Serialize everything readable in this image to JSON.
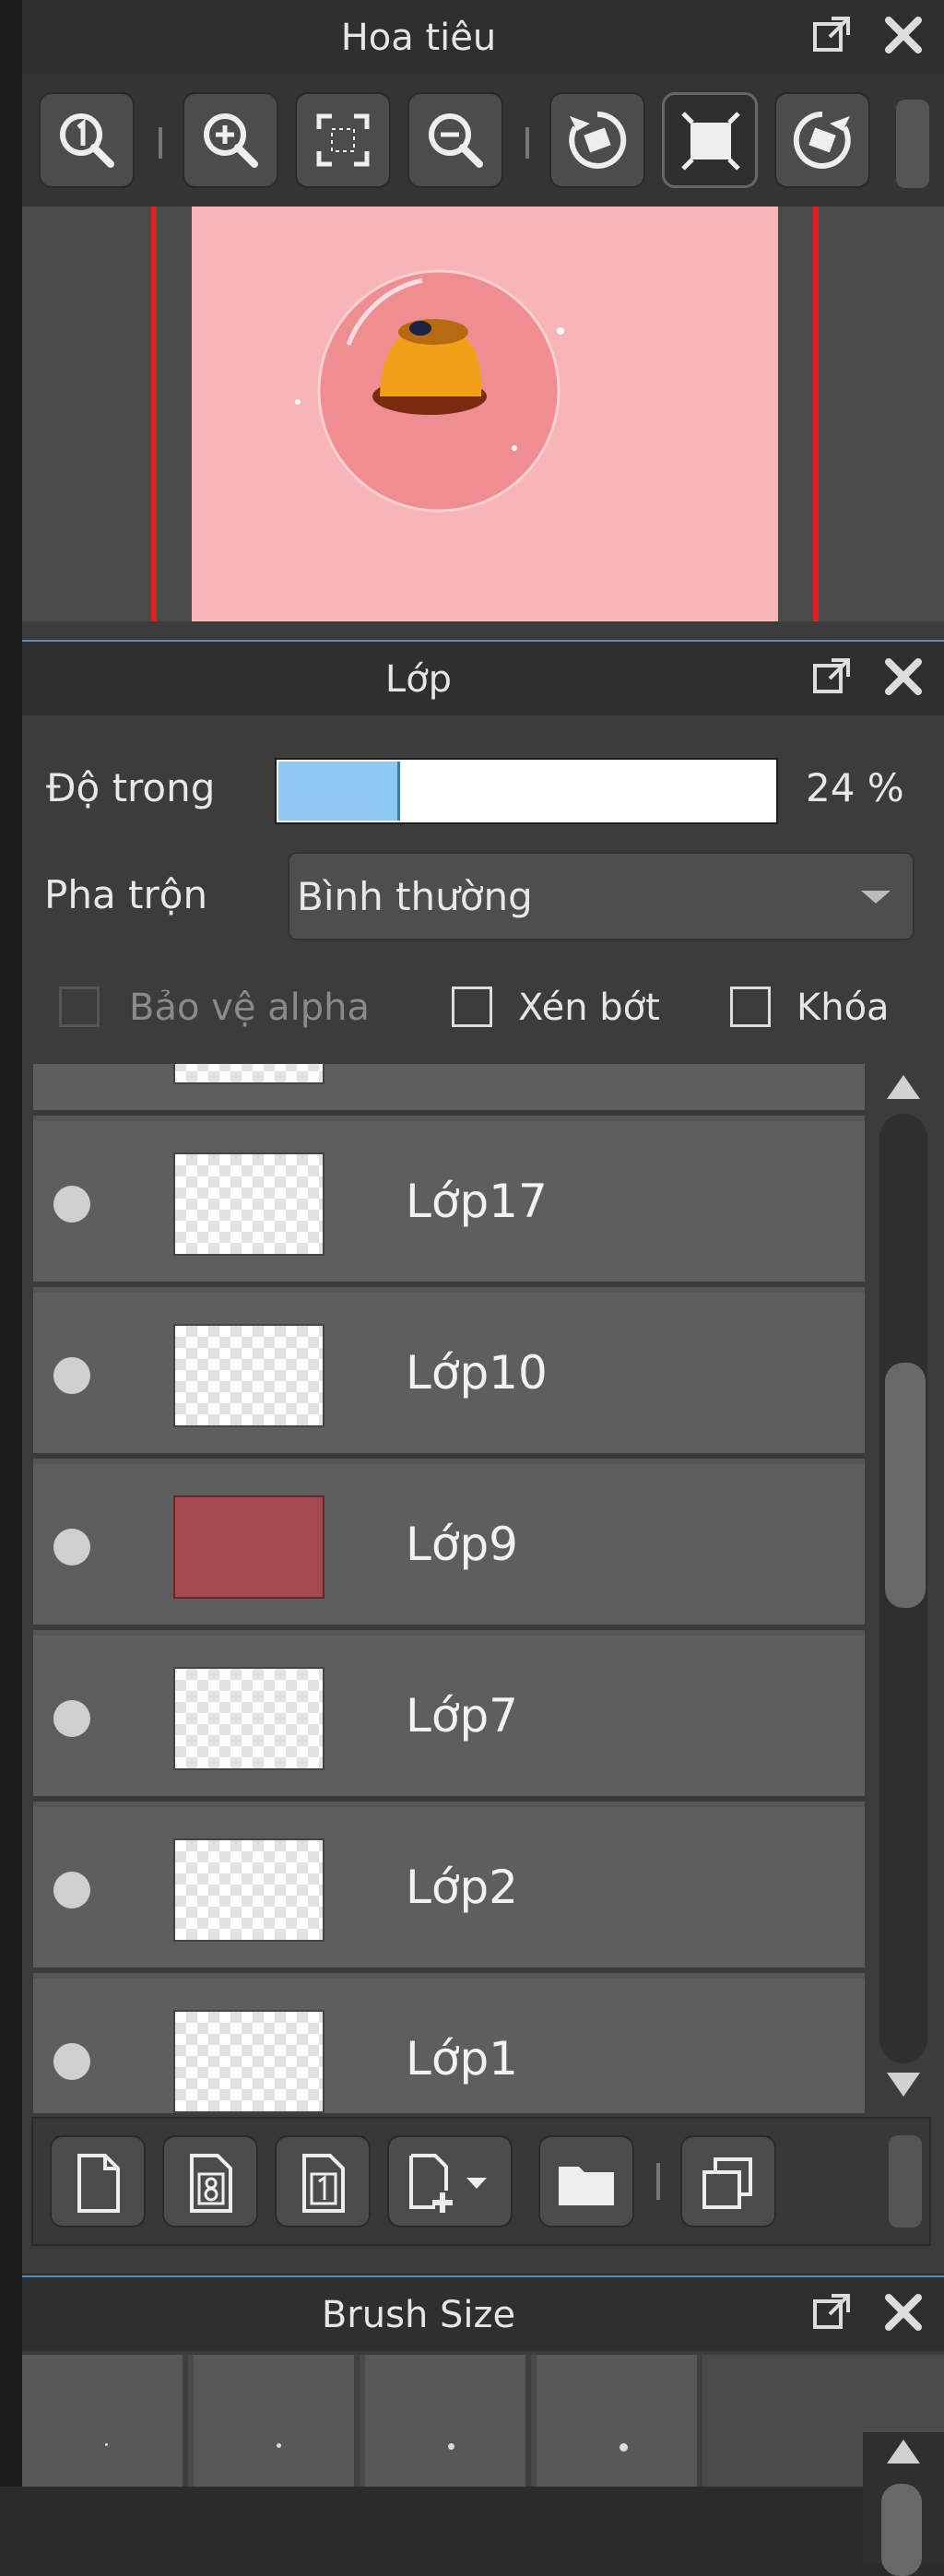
{
  "navigator": {
    "title": "Hoa tiêu",
    "buttons": [
      "zoom-actual-icon",
      "zoom-in-icon",
      "fit-screen-icon",
      "zoom-out-icon",
      "rotate-left-icon",
      "fit-frame-icon",
      "rotate-right-icon"
    ]
  },
  "layer": {
    "title": "Lớp",
    "opacity_label": "Độ trong",
    "opacity_value": "24 %",
    "opacity_fraction": 0.24,
    "blend_label": "Pha trộn",
    "blend_value": "Bình thường",
    "protect_alpha_label": "Bảo vệ alpha",
    "clip_label": "Xén bớt",
    "lock_label": "Khóa",
    "layers": [
      {
        "name": "Lớp17",
        "thumb": "transparent"
      },
      {
        "name": "Lớp10",
        "thumb": "transparent"
      },
      {
        "name": "Lớp9",
        "thumb": "solid",
        "color": "#a64a50"
      },
      {
        "name": "Lớp7",
        "thumb": "transparent"
      },
      {
        "name": "Lớp2",
        "thumb": "transparent"
      },
      {
        "name": "Lớp1",
        "thumb": "transparent"
      }
    ],
    "toolbar": [
      "new-layer-icon",
      "new-layer-8bit-icon",
      "new-layer-1bit-icon",
      "add-layer-menu-icon",
      "folder-icon",
      "duplicate-layer-icon"
    ]
  },
  "brush": {
    "title": "Brush Size"
  },
  "colors": {
    "accent": "#4a90c2",
    "canvas_bg": "#f8b5b7",
    "frame_red": "#e02020"
  }
}
